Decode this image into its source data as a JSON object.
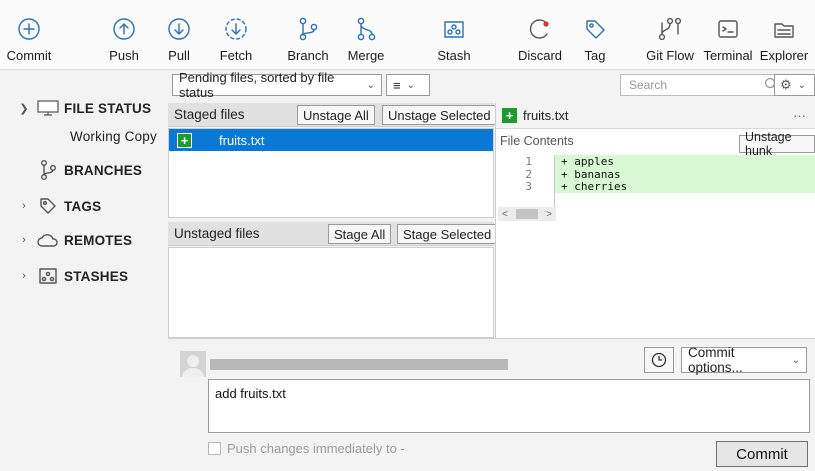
{
  "toolbar": {
    "commit": "Commit",
    "push": "Push",
    "pull": "Pull",
    "fetch": "Fetch",
    "branch": "Branch",
    "merge": "Merge",
    "stash": "Stash",
    "discard": "Discard",
    "tag": "Tag",
    "git_flow": "Git Flow",
    "terminal": "Terminal",
    "explorer": "Explorer"
  },
  "sidebar": {
    "file_status": "FILE STATUS",
    "working_copy": "Working Copy",
    "branches": "BRANCHES",
    "tags": "TAGS",
    "remotes": "REMOTES",
    "stashes": "STASHES"
  },
  "filter": {
    "sort_label": "Pending files, sorted by file status",
    "search_placeholder": "Search"
  },
  "staged": {
    "header": "Staged files",
    "unstage_all": "Unstage All",
    "unstage_selected": "Unstage Selected",
    "files": [
      "fruits.txt"
    ]
  },
  "unstaged": {
    "header": "Unstaged files",
    "stage_all": "Stage All",
    "stage_selected": "Stage Selected"
  },
  "diff": {
    "file_name": "fruits.txt",
    "more": "···",
    "section_label": "File Contents",
    "unstage_hunk": "Unstage hunk",
    "lines": [
      {
        "num": "1",
        "text": "+ apples"
      },
      {
        "num": "2",
        "text": "+ bananas"
      },
      {
        "num": "3",
        "text": "+ cherries"
      }
    ]
  },
  "commit": {
    "message": "add fruits.txt",
    "options": "Commit options...",
    "push_immediately": "Push changes immediately to -",
    "button": "Commit"
  },
  "colors": {
    "accent_blue": "#2d6fb3",
    "selection": "#0a78d7",
    "added_line_bg": "#d8f8d4",
    "file_added_green": "#1f9a2e",
    "discard_red": "#d33"
  }
}
